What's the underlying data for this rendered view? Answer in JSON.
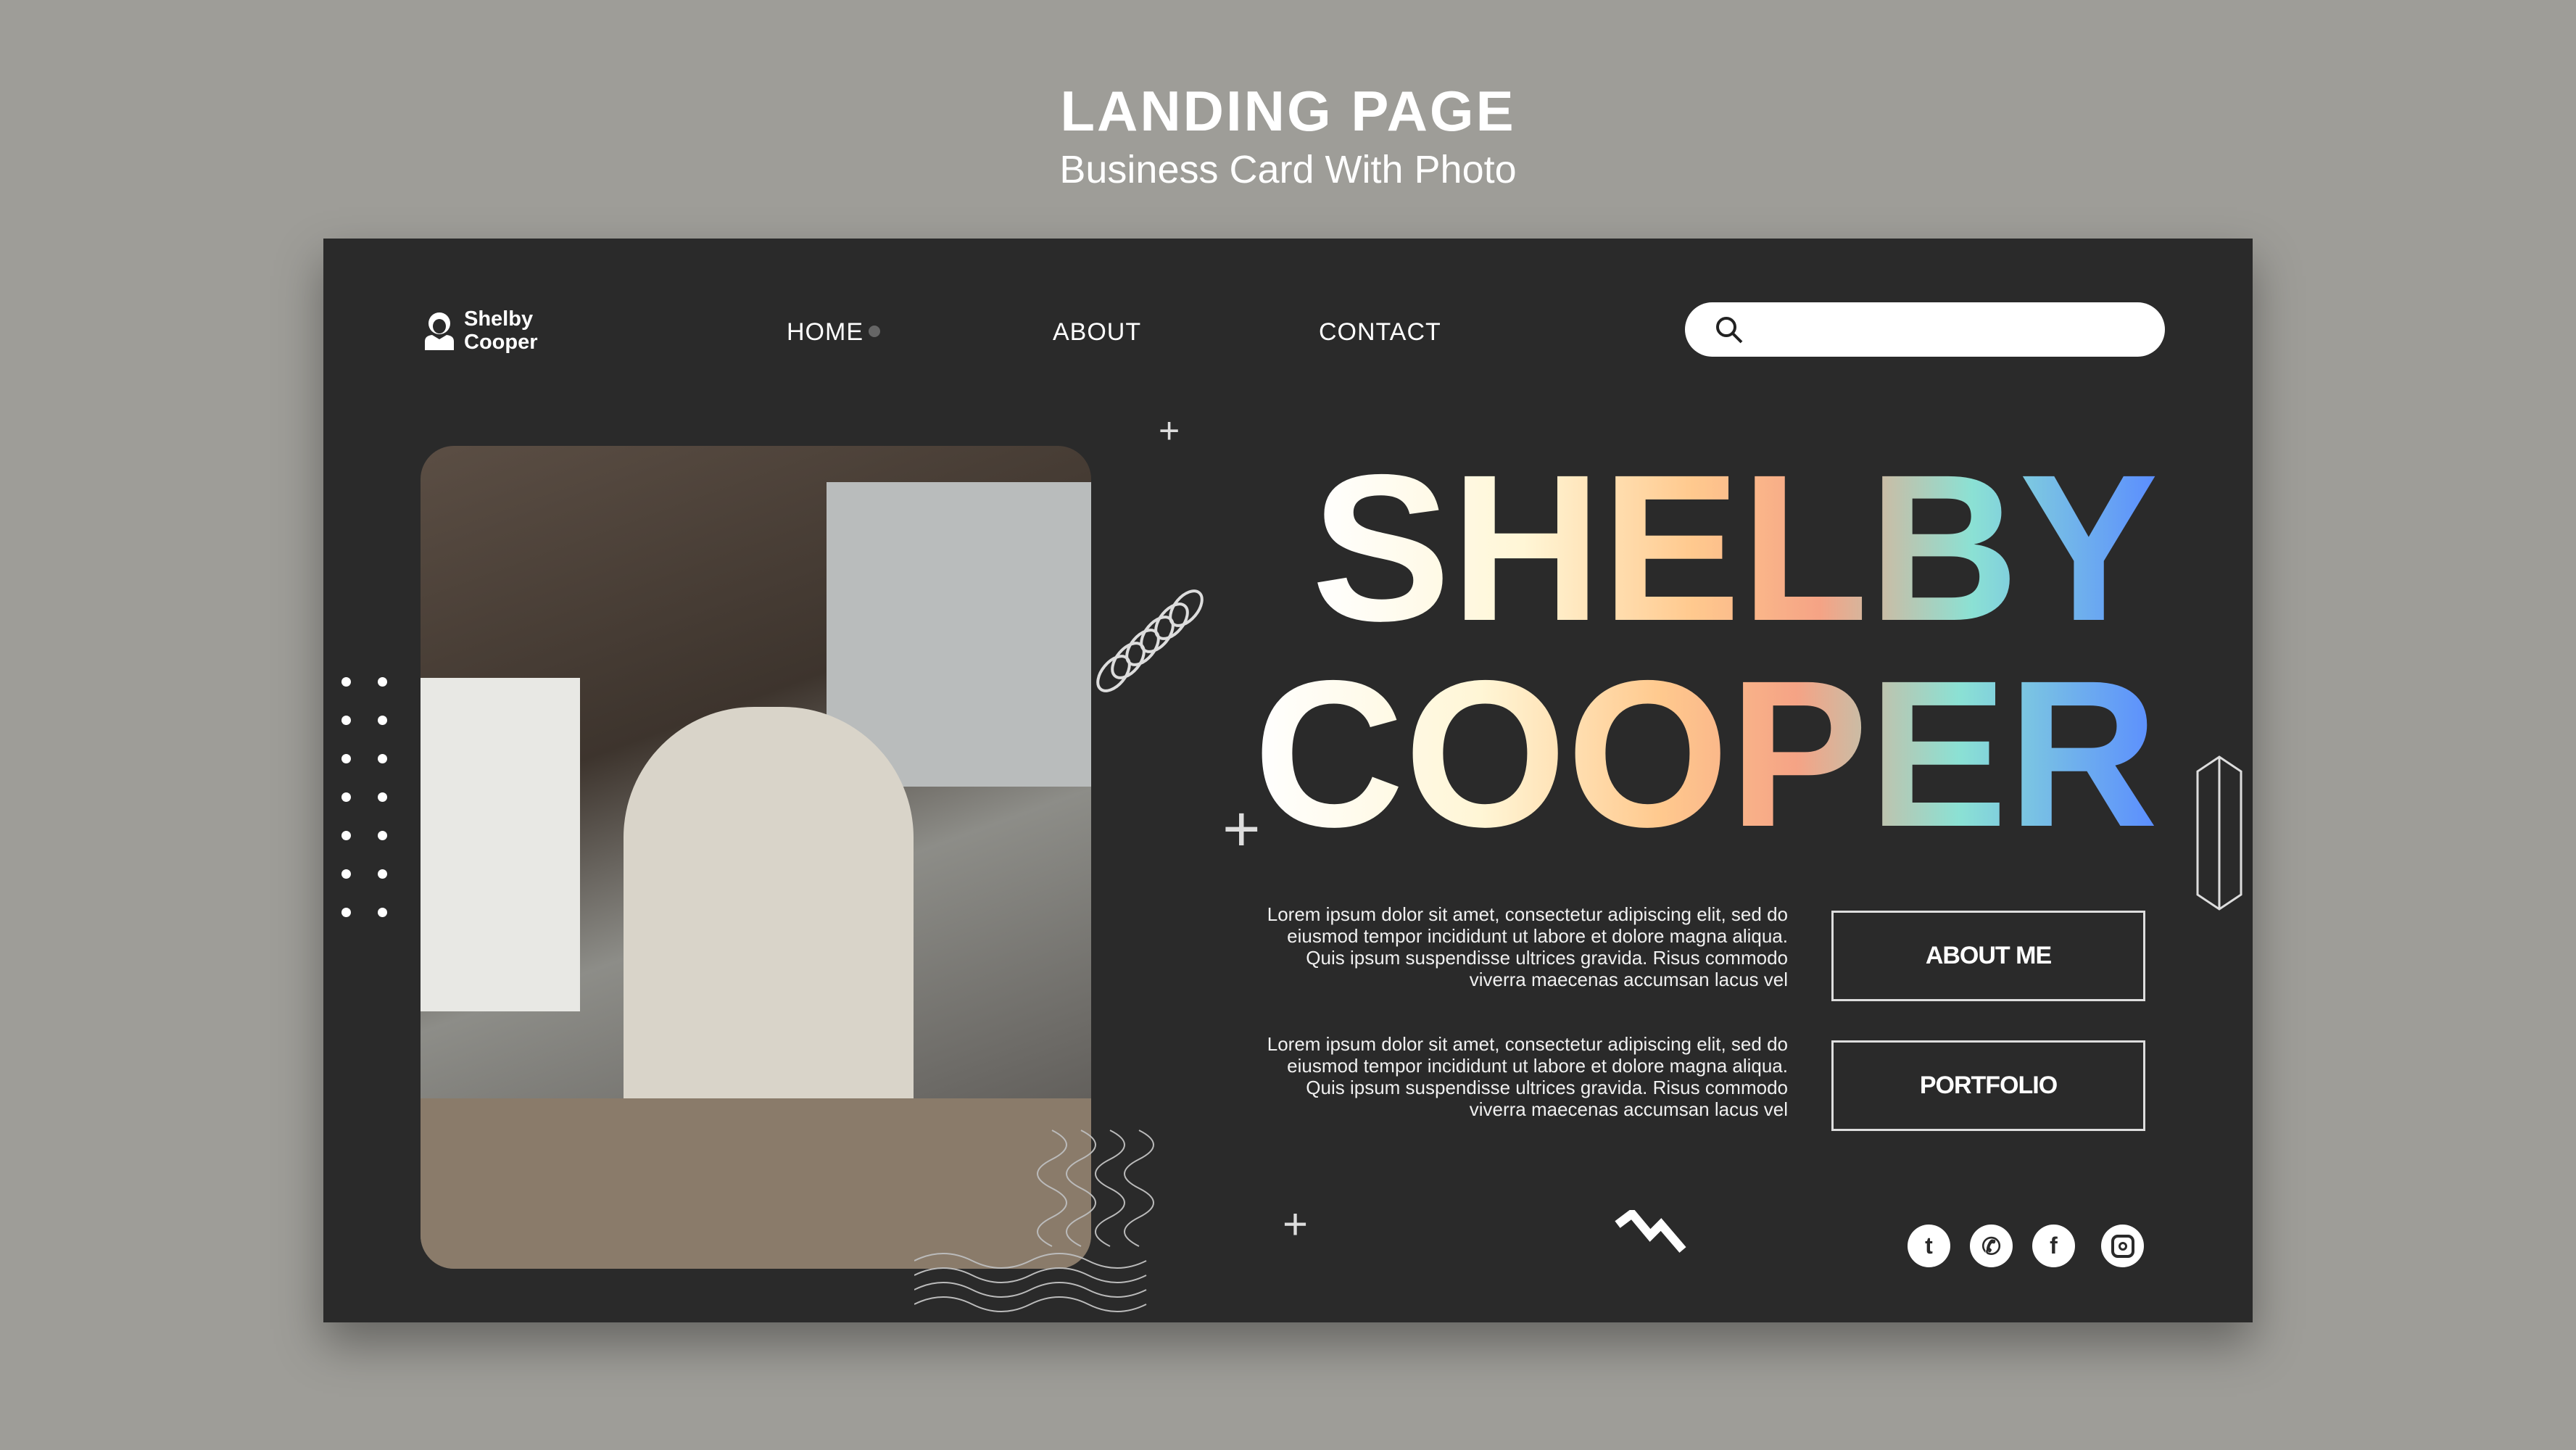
{
  "header": {
    "title": "LANDING PAGE",
    "subtitle": "Business Card With Photo"
  },
  "logo": {
    "line1": "Shelby",
    "line2": "Cooper"
  },
  "nav": [
    {
      "label": "HOME"
    },
    {
      "label": "ABOUT"
    },
    {
      "label": "CONTACT"
    }
  ],
  "search": {
    "placeholder": "",
    "value": ""
  },
  "hero": {
    "first": "SHELBY",
    "last": "COOPER"
  },
  "paragraphs": [
    "Lorem ipsum dolor sit amet, consectetur adipiscing elit, sed do eiusmod tempor incididunt ut labore et dolore magna aliqua. Quis ipsum suspendisse ultrices gravida. Risus commodo viverra maecenas accumsan lacus vel",
    "Lorem ipsum dolor sit amet, consectetur adipiscing elit, sed do eiusmod tempor incididunt ut labore et dolore magna aliqua. Quis ipsum suspendisse ultrices gravida. Risus commodo viverra maecenas accumsan lacus vel"
  ],
  "buttons": {
    "about": "ABOUT ME",
    "portfolio": "PORTFOLIO"
  },
  "social": [
    "twitter-icon",
    "whatsapp-icon",
    "facebook-icon",
    "instagram-icon"
  ],
  "colors": {
    "background": "#9e9d98",
    "card": "#2a2a2a"
  }
}
